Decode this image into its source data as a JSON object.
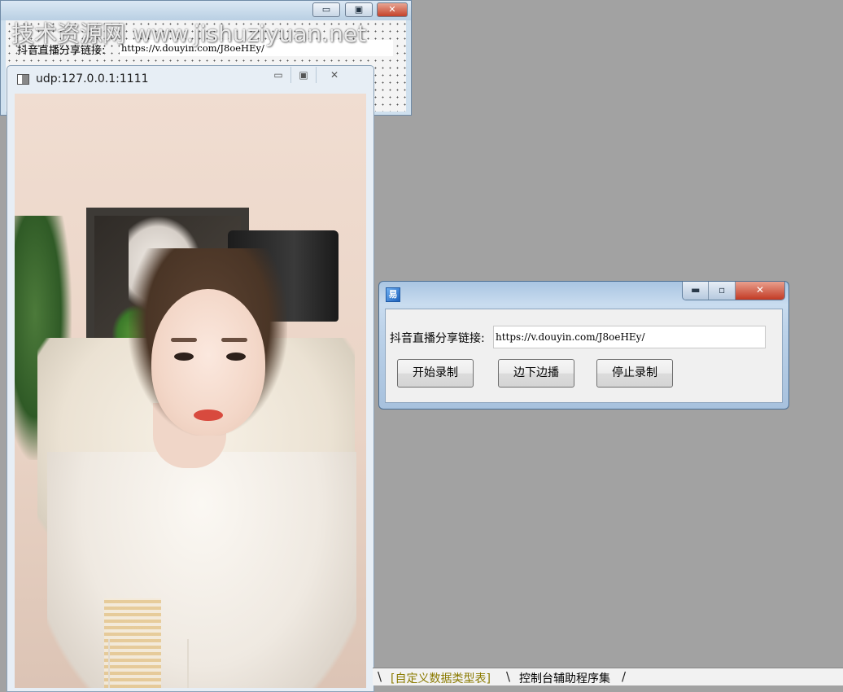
{
  "designer": {
    "label": "抖音直播分享链接:",
    "url_value": "https://v.douyin.com/J8oeHEy/",
    "min_glyph": "▭",
    "max_glyph": "▣",
    "close_glyph": "✕"
  },
  "watermark": {
    "text": "技术资源网 www.jishuziyuan.net"
  },
  "video_window": {
    "title": "udp:127.0.0.1:1111",
    "min_glyph": "▭",
    "max_glyph": "▣",
    "close_glyph": "✕"
  },
  "app_window": {
    "icon_glyph": "易",
    "min_glyph": "▬",
    "max_glyph": "▫",
    "close_glyph": "✕",
    "share_label": "抖音直播分享链接:",
    "url_value": "https://v.douyin.com/J8oeHEy/",
    "buttons": {
      "start": "开始录制",
      "watch": "边下边播",
      "stop": "停止录制"
    }
  },
  "tabbar": {
    "sep": "\\",
    "sep_end": "/",
    "tabs": [
      {
        "label": "[自定义数据类型表]",
        "color": "#8a7a00"
      },
      {
        "label": "控制台辅助程序集",
        "color": "#000000"
      }
    ]
  }
}
